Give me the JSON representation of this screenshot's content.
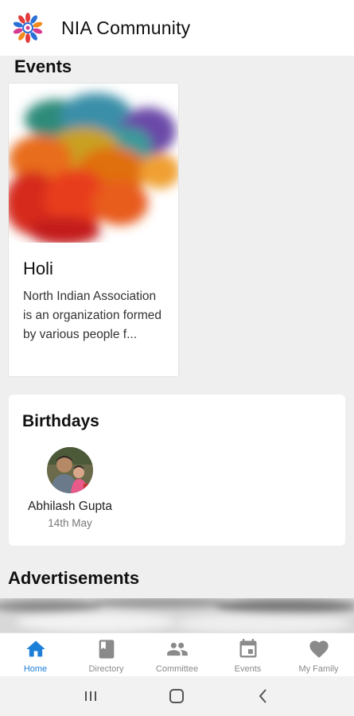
{
  "app": {
    "title": "NIA Community"
  },
  "events": {
    "section_title": "Events",
    "items": [
      {
        "name": "Holi",
        "description": "North Indian Association is an organization formed by various people f..."
      }
    ]
  },
  "birthdays": {
    "section_title": "Birthdays",
    "people": [
      {
        "name": "Abhilash Gupta",
        "date": "14th May"
      }
    ]
  },
  "advertisements": {
    "section_title": "Advertisements"
  },
  "bottom_nav": {
    "active": "Home",
    "items": [
      {
        "label": "Home",
        "icon": "home-icon"
      },
      {
        "label": "Directory",
        "icon": "book-icon"
      },
      {
        "label": "Committee",
        "icon": "people-icon"
      },
      {
        "label": "Events",
        "icon": "calendar-icon"
      },
      {
        "label": "My Family",
        "icon": "heart-icon"
      }
    ]
  },
  "colors": {
    "accent": "#1e7fd8",
    "background": "#efefef",
    "nav_inactive": "#8a8a8a"
  }
}
